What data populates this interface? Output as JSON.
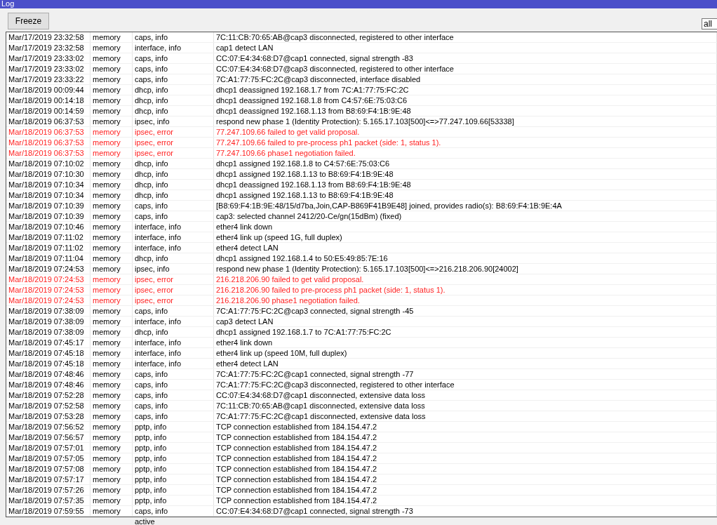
{
  "window": {
    "title": "Log"
  },
  "toolbar": {
    "button": "Freeze",
    "filter_value": "all"
  },
  "rows": [
    {
      "time": "Mar/17/2019 23:32:58",
      "buffer": "memory",
      "topics": "caps, info",
      "message": "7C:11:CB:70:65:AB@cap3 disconnected, registered to other interface",
      "kind": "info"
    },
    {
      "time": "Mar/17/2019 23:32:58",
      "buffer": "memory",
      "topics": "interface, info",
      "message": "cap1 detect LAN",
      "kind": "info"
    },
    {
      "time": "Mar/17/2019 23:33:02",
      "buffer": "memory",
      "topics": "caps, info",
      "message": "CC:07:E4:34:68:D7@cap1 connected, signal strength -83",
      "kind": "info"
    },
    {
      "time": "Mar/17/2019 23:33:02",
      "buffer": "memory",
      "topics": "caps, info",
      "message": "CC:07:E4:34:68:D7@cap3 disconnected, registered to other interface",
      "kind": "info"
    },
    {
      "time": "Mar/17/2019 23:33:22",
      "buffer": "memory",
      "topics": "caps, info",
      "message": "7C:A1:77:75:FC:2C@cap3 disconnected, interface disabled",
      "kind": "info"
    },
    {
      "time": "Mar/18/2019 00:09:44",
      "buffer": "memory",
      "topics": "dhcp, info",
      "message": "dhcp1 deassigned 192.168.1.7 from 7C:A1:77:75:FC:2C",
      "kind": "info"
    },
    {
      "time": "Mar/18/2019 00:14:18",
      "buffer": "memory",
      "topics": "dhcp, info",
      "message": "dhcp1 deassigned 192.168.1.8 from C4:57:6E:75:03:C6",
      "kind": "info"
    },
    {
      "time": "Mar/18/2019 00:14:59",
      "buffer": "memory",
      "topics": "dhcp, info",
      "message": "dhcp1 deassigned 192.168.1.13 from B8:69:F4:1B:9E:48",
      "kind": "info"
    },
    {
      "time": "Mar/18/2019 06:37:53",
      "buffer": "memory",
      "topics": "ipsec, info",
      "message": "respond new phase 1 (Identity Protection): 5.165.17.103[500]<=>77.247.109.66[53338]",
      "kind": "info"
    },
    {
      "time": "Mar/18/2019 06:37:53",
      "buffer": "memory",
      "topics": "ipsec, error",
      "message": "77.247.109.66 failed to get valid proposal.",
      "kind": "error"
    },
    {
      "time": "Mar/18/2019 06:37:53",
      "buffer": "memory",
      "topics": "ipsec, error",
      "message": "77.247.109.66 failed to pre-process ph1 packet (side: 1, status 1).",
      "kind": "error"
    },
    {
      "time": "Mar/18/2019 06:37:53",
      "buffer": "memory",
      "topics": "ipsec, error",
      "message": "77.247.109.66 phase1 negotiation failed.",
      "kind": "error"
    },
    {
      "time": "Mar/18/2019 07:10:02",
      "buffer": "memory",
      "topics": "dhcp, info",
      "message": "dhcp1 assigned 192.168.1.8 to C4:57:6E:75:03:C6",
      "kind": "info"
    },
    {
      "time": "Mar/18/2019 07:10:30",
      "buffer": "memory",
      "topics": "dhcp, info",
      "message": "dhcp1 assigned 192.168.1.13 to B8:69:F4:1B:9E:48",
      "kind": "info"
    },
    {
      "time": "Mar/18/2019 07:10:34",
      "buffer": "memory",
      "topics": "dhcp, info",
      "message": "dhcp1 deassigned 192.168.1.13 from B8:69:F4:1B:9E:48",
      "kind": "info"
    },
    {
      "time": "Mar/18/2019 07:10:34",
      "buffer": "memory",
      "topics": "dhcp, info",
      "message": "dhcp1 assigned 192.168.1.13 to B8:69:F4:1B:9E:48",
      "kind": "info"
    },
    {
      "time": "Mar/18/2019 07:10:39",
      "buffer": "memory",
      "topics": "caps, info",
      "message": "[B8:69:F4:1B:9E:48/15/d7ba,Join,CAP-B869F41B9E48] joined, provides radio(s): B8:69:F4:1B:9E:4A",
      "kind": "info"
    },
    {
      "time": "Mar/18/2019 07:10:39",
      "buffer": "memory",
      "topics": "caps, info",
      "message": "cap3: selected channel 2412/20-Ce/gn(15dBm) (fixed)",
      "kind": "info"
    },
    {
      "time": "Mar/18/2019 07:10:46",
      "buffer": "memory",
      "topics": "interface, info",
      "message": "ether4 link down",
      "kind": "info"
    },
    {
      "time": "Mar/18/2019 07:11:02",
      "buffer": "memory",
      "topics": "interface, info",
      "message": "ether4 link up (speed 1G, full duplex)",
      "kind": "info"
    },
    {
      "time": "Mar/18/2019 07:11:02",
      "buffer": "memory",
      "topics": "interface, info",
      "message": "ether4 detect LAN",
      "kind": "info"
    },
    {
      "time": "Mar/18/2019 07:11:04",
      "buffer": "memory",
      "topics": "dhcp, info",
      "message": "dhcp1 assigned 192.168.1.4 to 50:E5:49:85:7E:16",
      "kind": "info"
    },
    {
      "time": "Mar/18/2019 07:24:53",
      "buffer": "memory",
      "topics": "ipsec, info",
      "message": "respond new phase 1 (Identity Protection): 5.165.17.103[500]<=>216.218.206.90[24002]",
      "kind": "info"
    },
    {
      "time": "Mar/18/2019 07:24:53",
      "buffer": "memory",
      "topics": "ipsec, error",
      "message": "216.218.206.90 failed to get valid proposal.",
      "kind": "error"
    },
    {
      "time": "Mar/18/2019 07:24:53",
      "buffer": "memory",
      "topics": "ipsec, error",
      "message": "216.218.206.90 failed to pre-process ph1 packet (side: 1, status 1).",
      "kind": "error"
    },
    {
      "time": "Mar/18/2019 07:24:53",
      "buffer": "memory",
      "topics": "ipsec, error",
      "message": "216.218.206.90 phase1 negotiation failed.",
      "kind": "error"
    },
    {
      "time": "Mar/18/2019 07:38:09",
      "buffer": "memory",
      "topics": "caps, info",
      "message": "7C:A1:77:75:FC:2C@cap3 connected, signal strength -45",
      "kind": "info"
    },
    {
      "time": "Mar/18/2019 07:38:09",
      "buffer": "memory",
      "topics": "interface, info",
      "message": "cap3 detect LAN",
      "kind": "info"
    },
    {
      "time": "Mar/18/2019 07:38:09",
      "buffer": "memory",
      "topics": "dhcp, info",
      "message": "dhcp1 assigned 192.168.1.7 to 7C:A1:77:75:FC:2C",
      "kind": "info"
    },
    {
      "time": "Mar/18/2019 07:45:17",
      "buffer": "memory",
      "topics": "interface, info",
      "message": "ether4 link down",
      "kind": "info"
    },
    {
      "time": "Mar/18/2019 07:45:18",
      "buffer": "memory",
      "topics": "interface, info",
      "message": "ether4 link up (speed 10M, full duplex)",
      "kind": "info"
    },
    {
      "time": "Mar/18/2019 07:45:18",
      "buffer": "memory",
      "topics": "interface, info",
      "message": "ether4 detect LAN",
      "kind": "info"
    },
    {
      "time": "Mar/18/2019 07:48:46",
      "buffer": "memory",
      "topics": "caps, info",
      "message": "7C:A1:77:75:FC:2C@cap1 connected, signal strength -77",
      "kind": "info"
    },
    {
      "time": "Mar/18/2019 07:48:46",
      "buffer": "memory",
      "topics": "caps, info",
      "message": "7C:A1:77:75:FC:2C@cap3 disconnected, registered to other interface",
      "kind": "info"
    },
    {
      "time": "Mar/18/2019 07:52:28",
      "buffer": "memory",
      "topics": "caps, info",
      "message": "CC:07:E4:34:68:D7@cap1 disconnected, extensive data loss",
      "kind": "info"
    },
    {
      "time": "Mar/18/2019 07:52:58",
      "buffer": "memory",
      "topics": "caps, info",
      "message": "7C:11:CB:70:65:AB@cap1 disconnected, extensive data loss",
      "kind": "info"
    },
    {
      "time": "Mar/18/2019 07:53:28",
      "buffer": "memory",
      "topics": "caps, info",
      "message": "7C:A1:77:75:FC:2C@cap1 disconnected, extensive data loss",
      "kind": "info"
    },
    {
      "time": "Mar/18/2019 07:56:52",
      "buffer": "memory",
      "topics": "pptp, info",
      "message": "TCP connection established from 184.154.47.2",
      "kind": "info"
    },
    {
      "time": "Mar/18/2019 07:56:57",
      "buffer": "memory",
      "topics": "pptp, info",
      "message": "TCP connection established from 184.154.47.2",
      "kind": "info"
    },
    {
      "time": "Mar/18/2019 07:57:01",
      "buffer": "memory",
      "topics": "pptp, info",
      "message": "TCP connection established from 184.154.47.2",
      "kind": "info"
    },
    {
      "time": "Mar/18/2019 07:57:05",
      "buffer": "memory",
      "topics": "pptp, info",
      "message": "TCP connection established from 184.154.47.2",
      "kind": "info"
    },
    {
      "time": "Mar/18/2019 07:57:08",
      "buffer": "memory",
      "topics": "pptp, info",
      "message": "TCP connection established from 184.154.47.2",
      "kind": "info"
    },
    {
      "time": "Mar/18/2019 07:57:17",
      "buffer": "memory",
      "topics": "pptp, info",
      "message": "TCP connection established from 184.154.47.2",
      "kind": "info"
    },
    {
      "time": "Mar/18/2019 07:57:26",
      "buffer": "memory",
      "topics": "pptp, info",
      "message": "TCP connection established from 184.154.47.2",
      "kind": "info"
    },
    {
      "time": "Mar/18/2019 07:57:35",
      "buffer": "memory",
      "topics": "pptp, info",
      "message": "TCP connection established from 184.154.47.2",
      "kind": "info"
    },
    {
      "time": "Mar/18/2019 07:59:55",
      "buffer": "memory",
      "topics": "caps, info",
      "message": "CC:07:E4:34:68:D7@cap1 connected, signal strength -73",
      "kind": "info"
    }
  ],
  "status_bar": {
    "text": "active"
  }
}
